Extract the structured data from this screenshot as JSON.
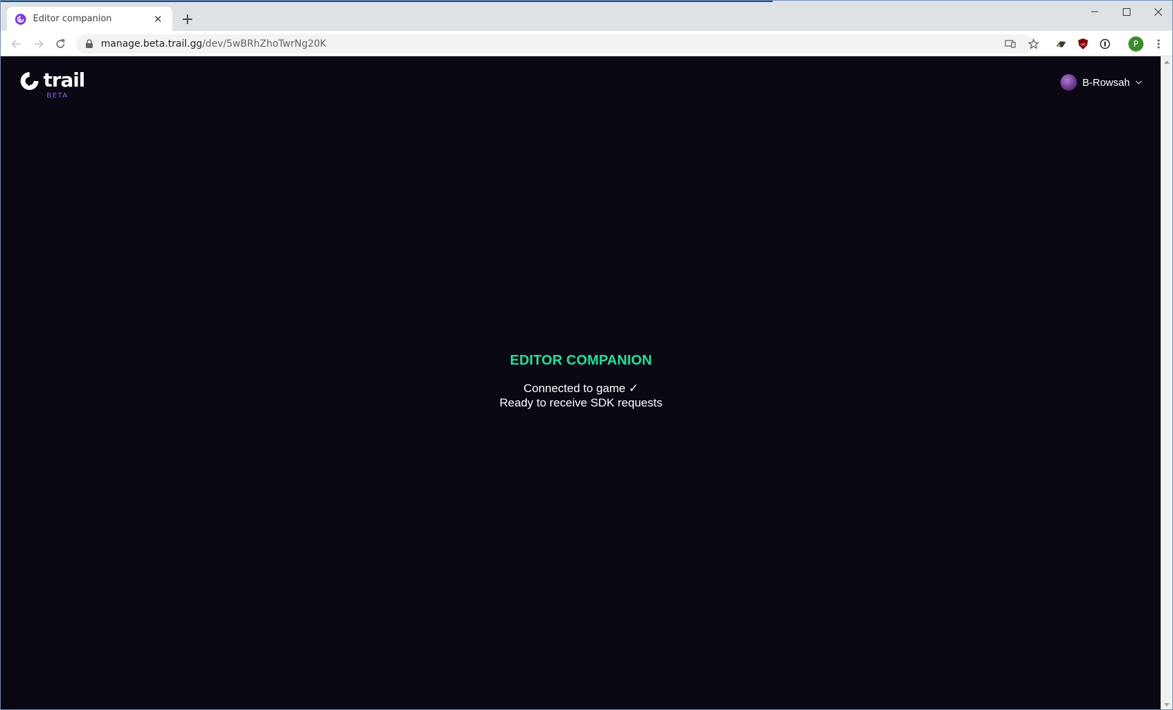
{
  "browser": {
    "tab": {
      "title": "Editor companion",
      "close": "✕"
    },
    "new_tab": "+",
    "url": {
      "host": "manage.beta.trail.gg",
      "path": "/dev/5wBRhZhoTwrNg20K"
    },
    "profile_initial": "P"
  },
  "page": {
    "logo": {
      "word": "trail",
      "badge": "BETA"
    },
    "user": {
      "name": "B-Rowsah"
    },
    "companion": {
      "heading": "EDITOR COMPANION",
      "status_lines": [
        "Connected to game ✓",
        "Ready to receive SDK requests"
      ]
    }
  },
  "colors": {
    "background": "#0a0812",
    "accent_green": "#1ee3a0",
    "brand_purple": "#7b3fe4"
  }
}
